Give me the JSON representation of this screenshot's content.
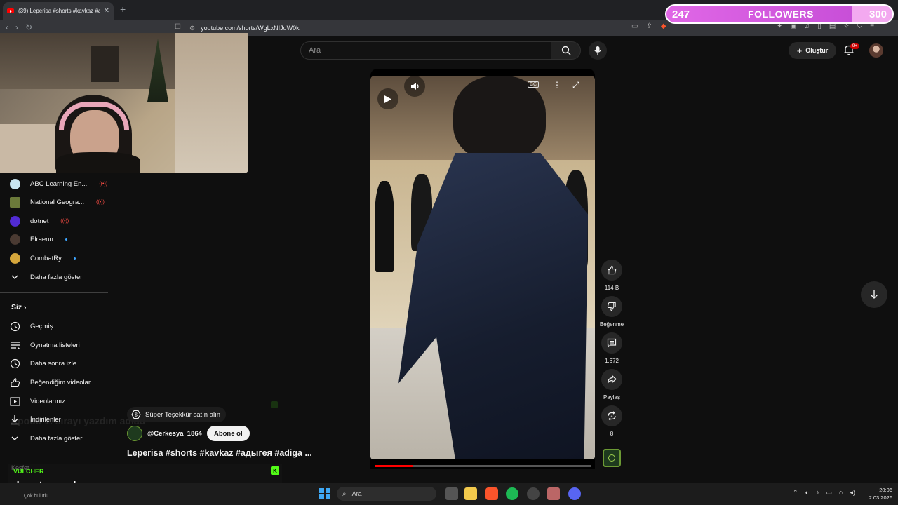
{
  "browser": {
    "tab_title": "(39) Leperisa #shorts #kavkaz #a",
    "url": "youtube.com/shorts/WgLxNIJuW0k"
  },
  "followers": {
    "current": "247",
    "label": "FOLLOWERS",
    "goal": "300",
    "progress": 0.82
  },
  "header": {
    "search_placeholder": "Ara",
    "create_label": "Oluştur",
    "notif_badge": "9+"
  },
  "sidebar": {
    "subscriptions": [
      {
        "name": "ABC Learning En...",
        "status": "live"
      },
      {
        "name": "National Geogra...",
        "status": "live"
      },
      {
        "name": "dotnet",
        "status": "live"
      },
      {
        "name": "Elraenn",
        "status": "new"
      },
      {
        "name": "CombatRy",
        "status": "new"
      }
    ],
    "show_more": "Daha fazla göster",
    "you_heading": "Siz",
    "you_items": [
      {
        "label": "Geçmiş",
        "icon": "history-icon"
      },
      {
        "label": "Oynatma listeleri",
        "icon": "playlist-icon"
      },
      {
        "label": "Daha sonra izle",
        "icon": "watch-later-icon"
      },
      {
        "label": "Beğendiğim videolar",
        "icon": "like-icon"
      },
      {
        "label": "Videolarınız",
        "icon": "your-videos-icon"
      },
      {
        "label": "İndirilenler",
        "icon": "download-icon"
      }
    ],
    "show_more_2": "Daha fazla göster"
  },
  "video": {
    "progress": 0.18,
    "thanks_label": "Süper Teşekkür satın alın",
    "channel": "@Cerkesya_1864",
    "subscribe_label": "Abone ol",
    "title": "Leperisa #shorts #kavkaz #адыгея #adiga ..."
  },
  "actions": {
    "likes": "114 B",
    "dislike_label": "Beğenme",
    "comments": "1.672",
    "share_label": "Paylaş",
    "remix_count": "8"
  },
  "overlay": {
    "ghost_text": "Apooo 1. sırayı yazdım adiad",
    "kesfet": "Keşfet",
    "chat_user": "VULCHER",
    "chat_message": "dua et yayındayız"
  },
  "taskbar": {
    "weather": "Çok bulutlu",
    "search_label": "Ara",
    "time": "20:06",
    "date": "2.03.2026"
  }
}
